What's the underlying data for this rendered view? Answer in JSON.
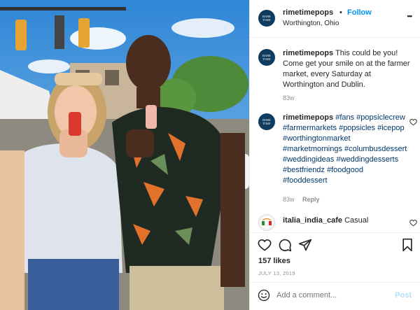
{
  "post": {
    "author": "rimetimepops",
    "avatar_text": "RIME TIME",
    "follow_separator": "•",
    "follow_label": "Follow",
    "location": "Worthington, Ohio",
    "more_label": "•••"
  },
  "caption": {
    "username": "rimetimepops",
    "text": "This could be you! Come get your smile on at the farmer market, every Saturday at Worthington and Dublin.",
    "age": "83w"
  },
  "hashtag_comment": {
    "username": "rimetimepops",
    "hashtags": "#fans #popsiclecrew #farmermarkets #popsicles #icepop #worthingtonmarket #marketmornings #columbusdessert #weddingideas #weddingdesserts #bestfriendz #foodgood #fooddessert",
    "age": "83w",
    "reply_label": "Reply"
  },
  "comment": {
    "username": "italia_india_cafe",
    "text": "Casual"
  },
  "likes": {
    "label": "157 likes"
  },
  "date": {
    "label": "JULY 13, 2019"
  },
  "comment_box": {
    "placeholder": "Add a comment...",
    "post_label": "Post"
  },
  "icons": [
    "heart-icon",
    "comment-icon",
    "share-icon",
    "bookmark-icon",
    "emoji-icon"
  ],
  "colors": {
    "link": "#0095f6",
    "hashtag": "#00376b",
    "avatar": "#0f3b5f",
    "muted": "#8e8e8e"
  }
}
